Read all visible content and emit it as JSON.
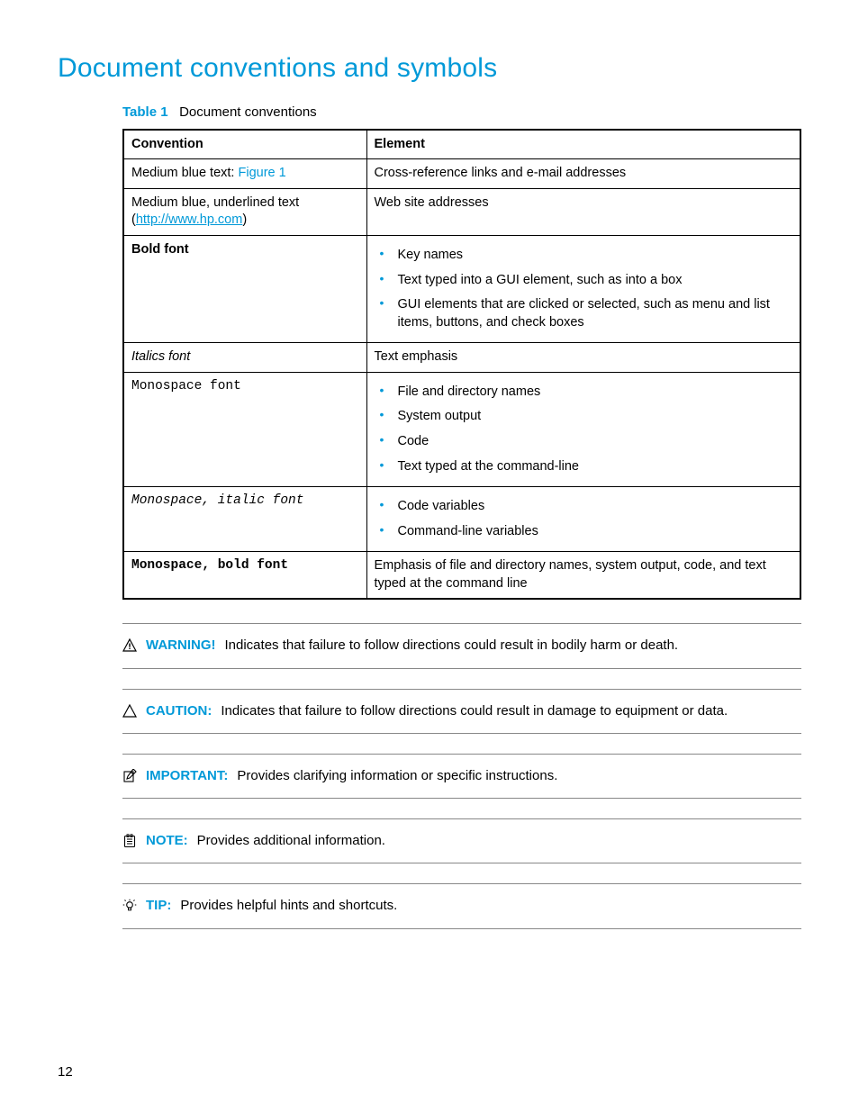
{
  "page": {
    "title": "Document conventions and symbols",
    "table_label": "Table 1",
    "table_title": "Document conventions",
    "page_number": "12"
  },
  "table": {
    "headers": {
      "col1": "Convention",
      "col2": "Element"
    },
    "rows": {
      "r1": {
        "conv_prefix": "Medium blue text: ",
        "conv_link": "Figure 1",
        "elem": "Cross-reference links and e-mail addresses"
      },
      "r2": {
        "conv_line1": "Medium blue, underlined text",
        "conv_link_open": "(",
        "conv_link": "http://www.hp.com",
        "conv_link_close": ")",
        "elem": "Web site addresses"
      },
      "r3": {
        "conv": "Bold font",
        "items": {
          "i1": "Key names",
          "i2": "Text typed into a GUI element, such as into a box",
          "i3": "GUI elements that are clicked or selected, such as menu and list items, buttons, and check boxes"
        }
      },
      "r4": {
        "conv": "Italics font",
        "elem": "Text emphasis"
      },
      "r5": {
        "conv": "Monospace font",
        "items": {
          "i1": "File and directory names",
          "i2": "System output",
          "i3": "Code",
          "i4": "Text typed at the command-line"
        }
      },
      "r6": {
        "conv": "Monospace, italic font",
        "items": {
          "i1": "Code variables",
          "i2": "Command-line variables"
        }
      },
      "r7": {
        "conv": "Monospace, bold font",
        "elem": "Emphasis of file and directory names, system output, code, and text typed at the command line"
      }
    }
  },
  "admonitions": {
    "warning": {
      "label": "WARNING!",
      "text": "Indicates that failure to follow directions could result in bodily harm or death."
    },
    "caution": {
      "label": "CAUTION:",
      "text": "Indicates that failure to follow directions could result in damage to equipment or data."
    },
    "important": {
      "label": "IMPORTANT:",
      "text": "Provides clarifying information or specific instructions."
    },
    "note": {
      "label": "NOTE:",
      "text": "Provides additional information."
    },
    "tip": {
      "label": "TIP:",
      "text": "Provides helpful hints and shortcuts."
    }
  }
}
